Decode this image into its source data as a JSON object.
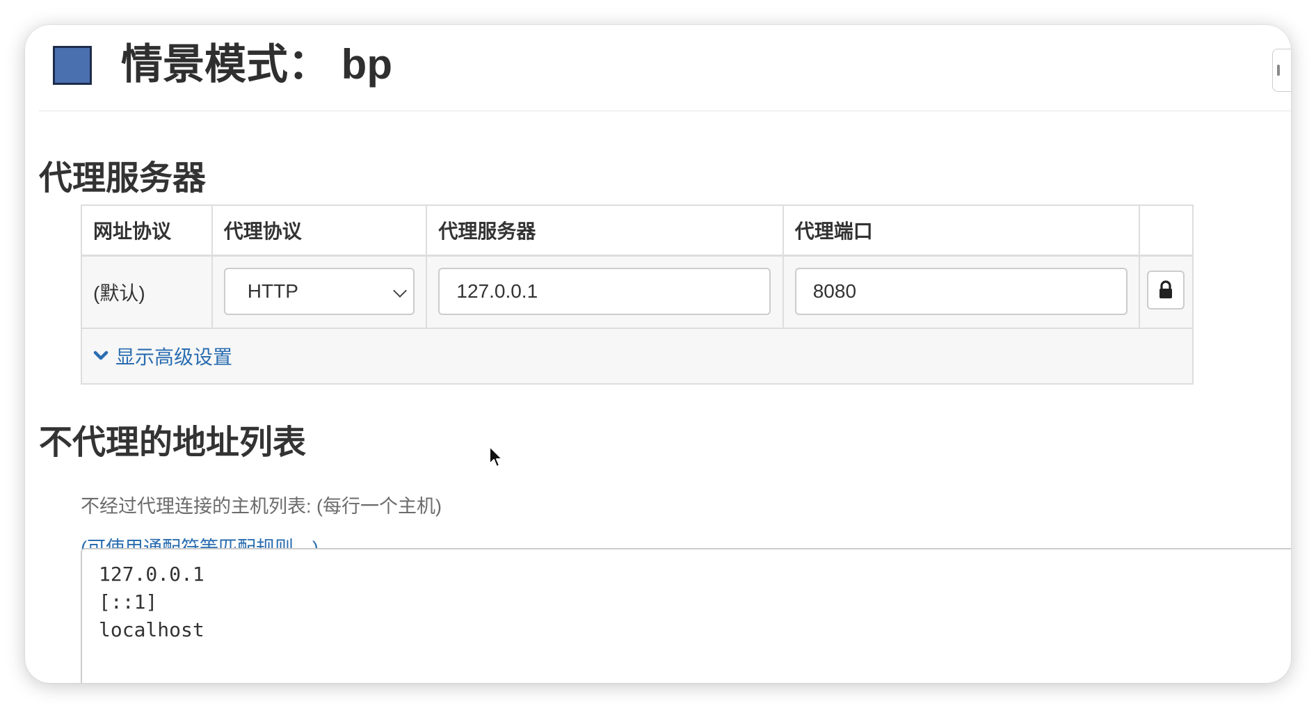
{
  "header": {
    "title": "情景模式： bp",
    "profile_color": "#4a70b0"
  },
  "proxy_section": {
    "heading": "代理服务器",
    "columns": [
      "网址协议",
      "代理协议",
      "代理服务器",
      "代理端口"
    ],
    "rows": [
      {
        "url_scheme": "(默认)",
        "protocol": "HTTP",
        "server": "127.0.0.1",
        "port": "8080"
      }
    ],
    "lock_icon": "lock-icon",
    "advanced_label": "显示高级设置",
    "advanced_icon": "chevron-down-icon"
  },
  "bypass_section": {
    "heading": "不代理的地址列表",
    "description": "不经过代理连接的主机列表: (每行一个主机)",
    "rules_link": "(可使用通配符等匹配规则…)",
    "entries": [
      "127.0.0.1",
      "[::1]",
      "localhost"
    ]
  },
  "colors": {
    "link": "#2a6db0",
    "table_border": "#dddddd",
    "row_bg": "#f7f7f7"
  }
}
